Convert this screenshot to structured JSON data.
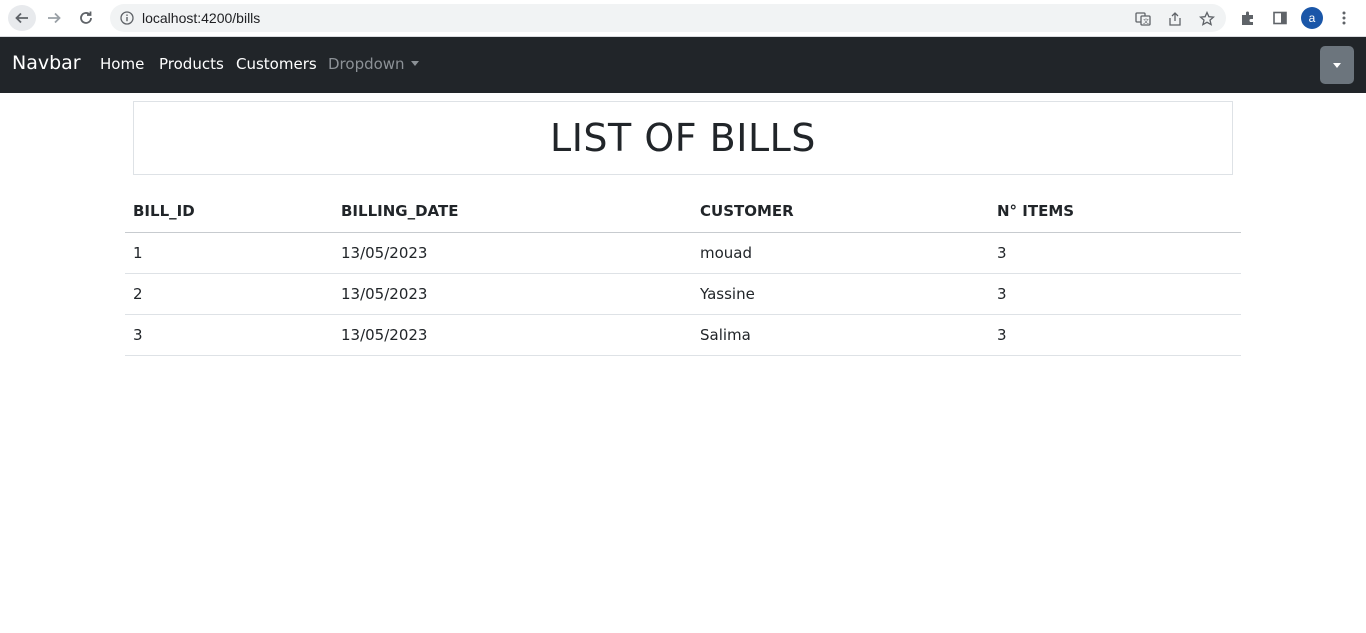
{
  "browser": {
    "url": "localhost:4200/bills",
    "profile_initial": "a"
  },
  "navbar": {
    "brand": "Navbar",
    "links": [
      "Home",
      "Products",
      "Customers"
    ],
    "dropdown_label": "Dropdown"
  },
  "page": {
    "title": "LIST OF BILLS"
  },
  "table": {
    "headers": [
      "BILL_ID",
      "BILLING_DATE",
      "CUSTOMER",
      "N° ITEMS"
    ],
    "rows": [
      [
        "1",
        "13/05/2023",
        "mouad",
        "3"
      ],
      [
        "2",
        "13/05/2023",
        "Yassine",
        "3"
      ],
      [
        "3",
        "13/05/2023",
        "Salima",
        "3"
      ]
    ]
  },
  "colors": {
    "navbar_bg": "#212529",
    "toggler_bg": "#6c757d",
    "avatar_bg": "#1a56a8"
  }
}
